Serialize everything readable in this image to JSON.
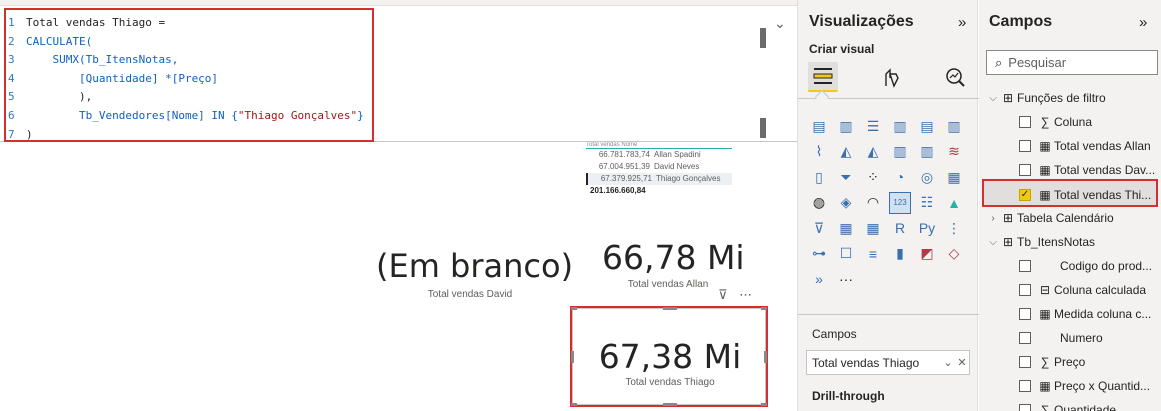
{
  "formula": {
    "lines": [
      {
        "num": "1",
        "parts": [
          {
            "t": "Total vendas Thiago =",
            "c": "plain"
          }
        ]
      },
      {
        "num": "2",
        "parts": [
          {
            "t": "CALCULATE(",
            "c": "kw"
          }
        ]
      },
      {
        "num": "3",
        "parts": [
          {
            "t": "    SUMX(Tb_ItensNotas,",
            "c": "kw"
          }
        ]
      },
      {
        "num": "4",
        "parts": [
          {
            "t": "        [Quantidade] *[Preço]",
            "c": "kw"
          }
        ]
      },
      {
        "num": "5",
        "parts": [
          {
            "t": "        ),",
            "c": "plain"
          }
        ]
      },
      {
        "num": "6",
        "parts": [
          {
            "t": "        Tb_Vendedores[Nome] IN {",
            "c": "kw"
          },
          {
            "t": "\"Thiago Gonçalves\"",
            "c": "str"
          },
          {
            "t": "}",
            "c": "kw"
          }
        ]
      },
      {
        "num": "7",
        "parts": [
          {
            "t": ")",
            "c": "plain"
          }
        ]
      }
    ]
  },
  "mini_table": {
    "header": "Total vendas   Nome",
    "rows": [
      {
        "value": "66.781.783,74",
        "name": "Allan Spadini",
        "selected": false
      },
      {
        "value": "67.004.951,39",
        "name": "David Neves",
        "selected": false
      },
      {
        "value": "67.379.925,71",
        "name": "Thiago Gonçalves",
        "selected": true
      }
    ],
    "total": "201.166.660,84"
  },
  "cards": {
    "david": {
      "value": "(Em branco)",
      "label": "Total vendas David"
    },
    "allan": {
      "value": "66,78 Mi",
      "label": "Total vendas Allan"
    },
    "thiago": {
      "value": "67,38 Mi",
      "label": "Total vendas Thiago"
    },
    "filter_icon": "filter-icon",
    "more_icon": "more-options-icon",
    "more_glyph": "⋯",
    "filter_glyph": "⊽"
  },
  "visualizations": {
    "title": "Visualizações",
    "collapse_glyph": "»",
    "create_visual": "Criar visual",
    "fields_section": "Campos",
    "field_well_value": "Total vendas Thiago",
    "drillthrough": "Drill-through",
    "more_glyph": "···"
  },
  "fields_pane": {
    "title": "Campos",
    "collapse_glyph": "»",
    "search_placeholder": "Pesquisar",
    "items": [
      {
        "label": "Funções de filtro",
        "level": 0,
        "expanded": true,
        "icon": "table-icon"
      },
      {
        "label": "Coluna",
        "level": 1,
        "icon": "sigma-icon",
        "checked": false
      },
      {
        "label": "Total vendas Allan",
        "level": 1,
        "icon": "calculator-icon",
        "checked": false
      },
      {
        "label": "Total vendas Dav...",
        "level": 1,
        "icon": "calculator-icon",
        "checked": false
      },
      {
        "label": "Total vendas Thi...",
        "level": 1,
        "icon": "calculator-icon",
        "checked": true
      },
      {
        "label": "Tabela Calendário",
        "level": 0,
        "expanded": false,
        "icon": "table-icon"
      },
      {
        "label": "Tb_ItensNotas",
        "level": 0,
        "expanded": true,
        "icon": "table-icon"
      },
      {
        "label": "Codigo do prod...",
        "level": 1,
        "icon": "none",
        "checked": false
      },
      {
        "label": "Coluna calculada",
        "level": 1,
        "icon": "calculated-column-icon",
        "checked": false
      },
      {
        "label": "Medida coluna c...",
        "level": 1,
        "icon": "calculator-icon",
        "checked": false
      },
      {
        "label": "Numero",
        "level": 1,
        "icon": "none",
        "checked": false
      },
      {
        "label": "Preço",
        "level": 1,
        "icon": "sigma-icon",
        "checked": false
      },
      {
        "label": "Preço x Quantid...",
        "level": 1,
        "icon": "calculator-icon",
        "checked": false
      },
      {
        "label": "Quantidade",
        "level": 1,
        "icon": "sigma-icon",
        "checked": false
      }
    ]
  },
  "colors": {
    "highlight_border": "#d32f2f",
    "accent_yellow": "#f2c811",
    "dax_keyword": "#1060c0",
    "dax_string": "#a31515"
  }
}
